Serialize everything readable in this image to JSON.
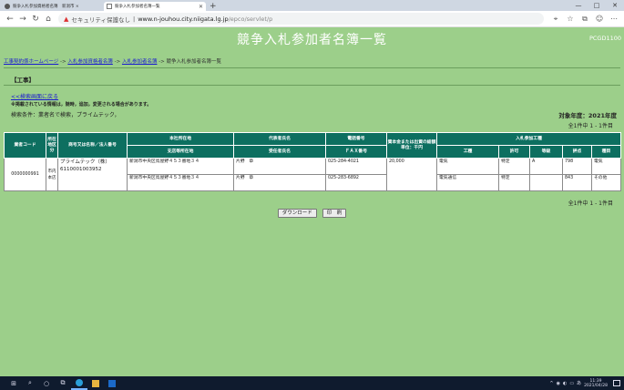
{
  "browser": {
    "tabs": [
      {
        "label": "競争入札参加資格者名簿　新潟市 ×",
        "active": false
      },
      {
        "label": "競争入札参加者名簿一覧",
        "active": true
      }
    ],
    "new_tab": "+",
    "window_controls": [
      "—",
      "□",
      "✕"
    ],
    "security_label": "セキュリティ保護なし",
    "url_host": "www.n-jouhou.city.niigata.lg.jp",
    "url_path": "/epco/servlet/p"
  },
  "page": {
    "title": "競争入札参加者名簿一覧",
    "id": "PCGD1100",
    "breadcrumb": [
      {
        "label": "工事契約係ホームページ",
        "link": true
      },
      {
        "label": "入札参加資格者名簿",
        "link": true
      },
      {
        "label": "入札参加者名簿",
        "link": true
      },
      {
        "label": "競争入札参加者名簿一覧",
        "link": false
      }
    ],
    "breadcrumb_sep": " -> ",
    "section": "【工事】",
    "back_link": "<<検索画面に戻る",
    "note": "※掲載されている情報は，随時，追加，変更される場合があります。",
    "condition": "検索条件：業者名で検索，プライムテック，",
    "fiscal_year": "対象年度：2021年度",
    "count_top": "全1件中 1 - 1件目",
    "count_bottom": "全1件中 1 - 1件目"
  },
  "table": {
    "headers": {
      "code": "業者コード",
      "district": "所在地区分",
      "name": "商号又は名称／法人番号",
      "address_hq": "本社所在地",
      "address_branch": "支店等所在地",
      "rep": "代表者氏名",
      "delegate": "受任者氏名",
      "phone": "電話番号",
      "fax": "ＦＡＸ番号",
      "capital": "資本金または出資の総額　単位：千円",
      "grade_group": "入札参加工種",
      "work": "工種",
      "permit": "許可",
      "rank": "等級",
      "score": "評点",
      "type": "種目"
    },
    "row": {
      "code": "0000000991",
      "district": "市内本店",
      "name": "プライムテック（株）",
      "corp_no": "6110001003952",
      "address_hq": "新潟市中央区鳥屋野４５３番地３４",
      "address_branch": "新潟市中央区鳥屋野４５３番地３４",
      "rep": "片野　章",
      "delegate": "片野　章",
      "phone": "025-284-4021",
      "fax": "025-283-6892",
      "capital": "20,000",
      "grades": [
        {
          "work": "電気",
          "permit": "特定",
          "rank": "A",
          "score": "798",
          "type": "電気"
        },
        {
          "work": "電気通信",
          "permit": "特定",
          "rank": "",
          "score": "843",
          "type": "その他"
        }
      ]
    }
  },
  "buttons": {
    "download": "ダウンロード",
    "print": "印　刷"
  },
  "taskbar": {
    "time": "11:39",
    "date": "2021/04/28",
    "ime": "あ"
  }
}
